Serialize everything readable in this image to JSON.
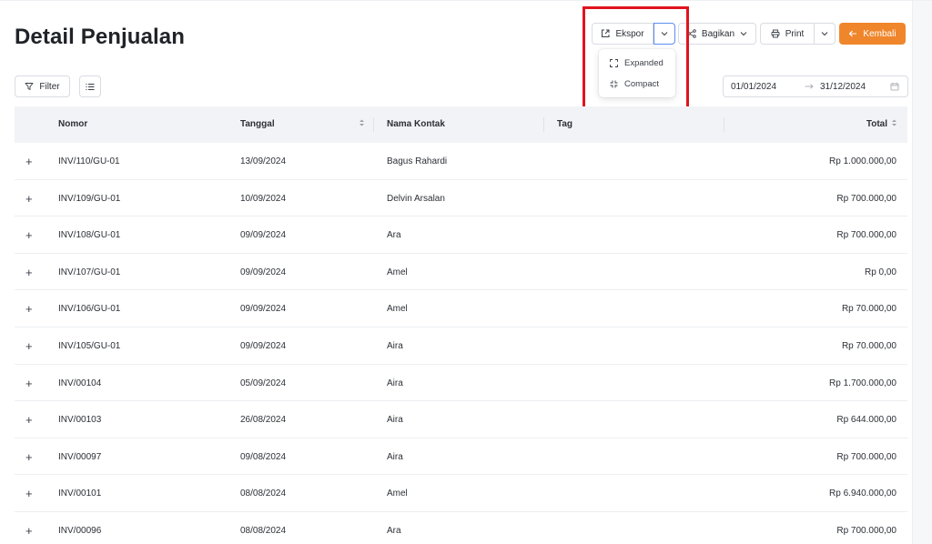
{
  "page": {
    "title": "Detail Penjualan"
  },
  "toolbar": {
    "export_label": "Ekspor",
    "share_label": "Bagikan",
    "print_label": "Print",
    "back_label": "Kembali",
    "filter_label": "Filter"
  },
  "export_menu": {
    "items": [
      {
        "label": "Expanded",
        "icon": "expand-icon"
      },
      {
        "label": "Compact",
        "icon": "compact-icon"
      }
    ]
  },
  "date_range": {
    "start": "01/01/2024",
    "end": "31/12/2024"
  },
  "table": {
    "headers": {
      "nomor": "Nomor",
      "tanggal": "Tanggal",
      "kontak": "Nama Kontak",
      "tag": "Tag",
      "total": "Total"
    },
    "rows": [
      {
        "nomor": "INV/110/GU-01",
        "tanggal": "13/09/2024",
        "kontak": "Bagus Rahardi",
        "tag": "",
        "total": "Rp 1.000.000,00"
      },
      {
        "nomor": "INV/109/GU-01",
        "tanggal": "10/09/2024",
        "kontak": "Delvin Arsalan",
        "tag": "",
        "total": "Rp 700.000,00"
      },
      {
        "nomor": "INV/108/GU-01",
        "tanggal": "09/09/2024",
        "kontak": "Ara",
        "tag": "",
        "total": "Rp 700.000,00"
      },
      {
        "nomor": "INV/107/GU-01",
        "tanggal": "09/09/2024",
        "kontak": "Amel",
        "tag": "",
        "total": "Rp 0,00"
      },
      {
        "nomor": "INV/106/GU-01",
        "tanggal": "09/09/2024",
        "kontak": "Amel",
        "tag": "",
        "total": "Rp 70.000,00"
      },
      {
        "nomor": "INV/105/GU-01",
        "tanggal": "09/09/2024",
        "kontak": "Aira",
        "tag": "",
        "total": "Rp 70.000,00"
      },
      {
        "nomor": "INV/00104",
        "tanggal": "05/09/2024",
        "kontak": "Aira",
        "tag": "",
        "total": "Rp 1.700.000,00"
      },
      {
        "nomor": "INV/00103",
        "tanggal": "26/08/2024",
        "kontak": "Aira",
        "tag": "",
        "total": "Rp 644.000,00"
      },
      {
        "nomor": "INV/00097",
        "tanggal": "09/08/2024",
        "kontak": "Aira",
        "tag": "",
        "total": "Rp 700.000,00"
      },
      {
        "nomor": "INV/00101",
        "tanggal": "08/08/2024",
        "kontak": "Amel",
        "tag": "",
        "total": "Rp 6.940.000,00"
      },
      {
        "nomor": "INV/00096",
        "tanggal": "08/08/2024",
        "kontak": "Ara",
        "tag": "",
        "total": "Rp 700.000,00"
      }
    ]
  },
  "colors": {
    "accent": "#f0862b",
    "highlight": "#e0141e",
    "header_bg": "#f2f3f6"
  }
}
